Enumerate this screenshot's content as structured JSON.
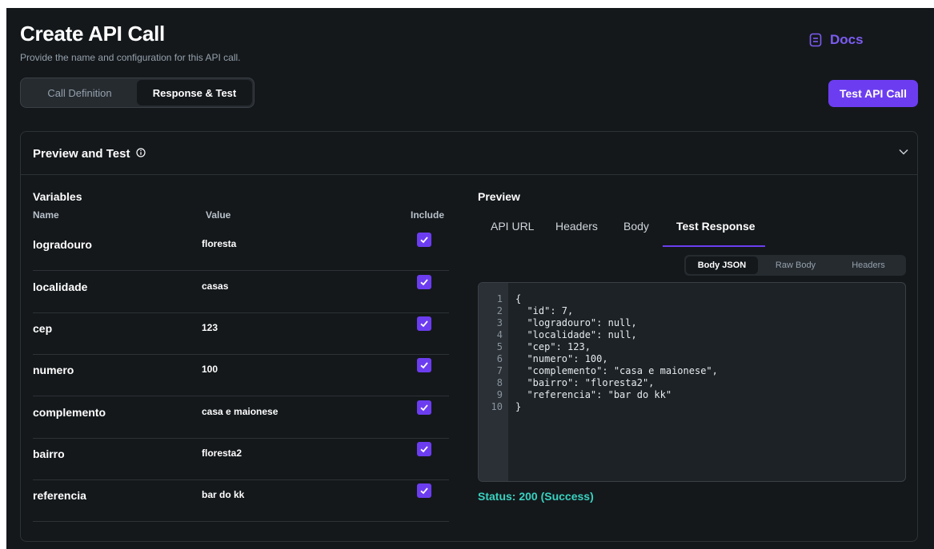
{
  "header": {
    "title": "Create API Call",
    "subtitle": "Provide the name and configuration for this API call.",
    "docs_label": "Docs"
  },
  "tabs": [
    {
      "label": "Call Definition",
      "active": false
    },
    {
      "label": "Response & Test",
      "active": true
    }
  ],
  "test_button": {
    "label": "Test API Call"
  },
  "panel": {
    "title": "Preview and Test"
  },
  "variables": {
    "title": "Variables",
    "columns": {
      "name": "Name",
      "value": "Value",
      "include": "Include"
    },
    "rows": [
      {
        "name": "logradouro",
        "value": "floresta",
        "include": true
      },
      {
        "name": "localidade",
        "value": "casas",
        "include": true
      },
      {
        "name": "cep",
        "value": "123",
        "include": true
      },
      {
        "name": "numero",
        "value": "100",
        "include": true
      },
      {
        "name": "complemento",
        "value": "casa e maionese",
        "include": true
      },
      {
        "name": "bairro",
        "value": "floresta2",
        "include": true
      },
      {
        "name": "referencia",
        "value": "bar do kk",
        "include": true
      }
    ]
  },
  "preview": {
    "title": "Preview",
    "tabs": [
      "API URL",
      "Headers",
      "Body",
      "Test Response"
    ],
    "active_tab": "Test Response",
    "response_tabs": [
      "Body JSON",
      "Raw Body",
      "Headers"
    ],
    "active_response_tab": "Body JSON",
    "line_numbers": "1\n2\n3\n4\n5\n6\n7\n8\n9\n10",
    "code": "{\n  \"id\": 7,\n  \"logradouro\": null,\n  \"localidade\": null,\n  \"cep\": 123,\n  \"numero\": 100,\n  \"complemento\": \"casa e maionese\",\n  \"bairro\": \"floresta2\",\n  \"referencia\": \"bar do kk\"\n}",
    "status": "Status: 200 (Success)"
  },
  "colors": {
    "background": "#14181b",
    "accent": "#6c3df0",
    "success": "#39d2c0",
    "muted": "#95a1ac"
  }
}
